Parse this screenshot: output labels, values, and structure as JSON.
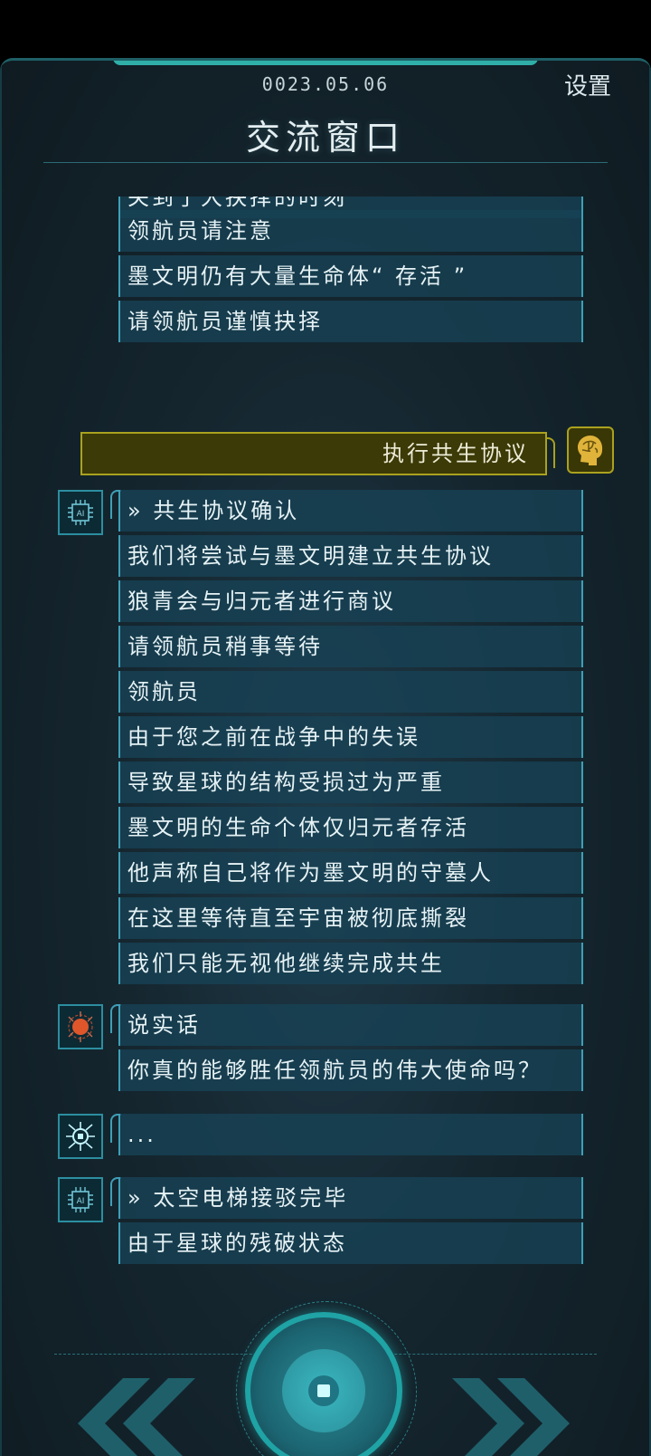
{
  "header": {
    "date": "0023.05.06",
    "settings_label": "设置",
    "title": "交流窗口"
  },
  "chat": {
    "clipped_top_line": "关到了大抉择的时刻",
    "warning_lines": [
      "领航员请注意",
      "墨文明仍有大量生命体“ 存活 ”",
      "请领航员谨慎抉择"
    ],
    "player_choice": "执行共生协议",
    "ai_block_1": [
      "» 共生协议确认",
      "我们将尝试与墨文明建立共生协议",
      "狼青会与归元者进行商议",
      "请领航员稍事等待",
      "领航员",
      "由于您之前在战争中的失误",
      "导致星球的结构受损过为严重",
      "墨文明的生命个体仅归元者存活",
      "他声称自己将作为墨文明的守墓人",
      "在这里等待直至宇宙被彻底撕裂",
      "我们只能无视他继续完成共生"
    ],
    "red_block": [
      "说实话",
      "你真的能够胜任领航员的伟大使命吗？"
    ],
    "bug_block": [
      "..."
    ],
    "ai_block_2": [
      "» 太空电梯接驳完毕",
      "由于星球的残破状态"
    ]
  },
  "icons": {
    "ai": "ai-chip-icon",
    "red": "red-brain-icon",
    "bug": "bug-chip-icon",
    "player": "player-head-icon",
    "prev": "double-chevron-left-icon",
    "next": "double-chevron-right-icon"
  },
  "colors": {
    "accent": "#35c9c0",
    "bubble": "#174256",
    "player_bubble": "#3c3a07",
    "player_border": "#aaa21e"
  }
}
